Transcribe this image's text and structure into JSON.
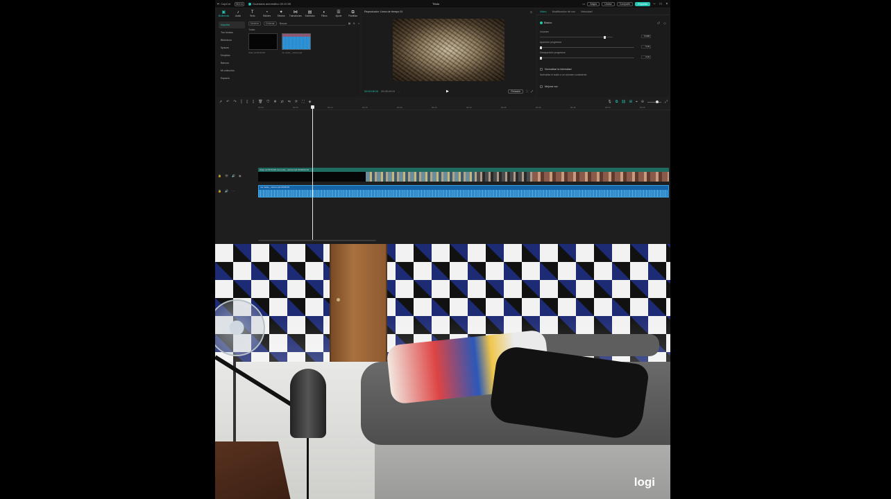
{
  "titlebar": {
    "app_name": "CapCut",
    "menu_label": "Menú",
    "autosave_text": "Guardado automático 00:10:05",
    "project_title": "Título",
    "shortcuts_label": "Atajos",
    "join_label": "Unirse",
    "share_label": "Compartir",
    "export_label": "Exportar"
  },
  "media_tools": [
    {
      "label": "Multimedia",
      "icon": "media-icon"
    },
    {
      "label": "Audio",
      "icon": "audio-icon"
    },
    {
      "label": "Texto",
      "icon": "text-icon"
    },
    {
      "label": "Stickers",
      "icon": "sticker-icon"
    },
    {
      "label": "Efectos",
      "icon": "effects-icon"
    },
    {
      "label": "Transiciones",
      "icon": "transition-icon"
    },
    {
      "label": "Subtítulos",
      "icon": "subtitle-icon"
    },
    {
      "label": "Filtros",
      "icon": "filter-icon"
    },
    {
      "label": "Ajuste",
      "icon": "adjust-icon"
    },
    {
      "label": "Plantillas",
      "icon": "template-icon"
    }
  ],
  "media_sidebar": [
    "Importar",
    "Tus fondos",
    "Biblioteca",
    "Spaces",
    "Dropbox",
    "Bancos",
    "Mi colección",
    "Espacio"
  ],
  "media_filter": {
    "all_label": "Mostrar",
    "sort_label": "Ordenar",
    "search_placeholder": "Buscar",
    "section_label": "Todas"
  },
  "media_items": [
    {
      "caption": "video ref 05 54:00",
      "type": "black"
    },
    {
      "caption": "ms music_ cobra.mp3",
      "type": "audio"
    }
  ],
  "player": {
    "title": "Reproductor: Línea de tiempo 01",
    "timecode": "00:00:08:16",
    "duration": "00:08:49:19",
    "ratio_label": "Relación"
  },
  "inspector": {
    "tabs": [
      "Video",
      "Modificación de voz",
      "Velocidad"
    ],
    "section_title": "Básico",
    "volume_label": "Volumen",
    "volume_value": "0.0dB",
    "fade_in_label": "Aparición progresiva",
    "fade_in_value": "0.0s",
    "fade_out_label": "Desaparición progresiva",
    "fade_out_value": "0.0s",
    "normalize_label": "Normalizar la intensidad",
    "normalize_desc": "Normaliza el audio a un volumen consistente",
    "enhance_label": "Mejorar voz"
  },
  "timeline": {
    "ruler_ticks": [
      "00:00",
      "00:05",
      "00:10",
      "00:15",
      "00:20",
      "00:25",
      "00:30",
      "00:35",
      "00:40",
      "00:45",
      "00:50",
      "00:55"
    ],
    "video_clip_title": "video ref 05 54:00 ms music_ cobra.mp4 00:08:00:19",
    "audio_clip_title": "ms music_ cobra.mp3 00:08:49"
  },
  "webcam": {
    "brand_logo": "logi"
  }
}
